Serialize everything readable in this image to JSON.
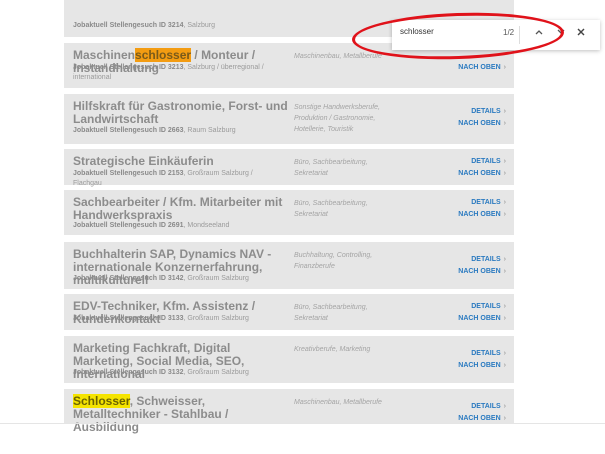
{
  "find": {
    "query": "schlosser",
    "count": "1/2",
    "up_icon": "chevron-up-icon",
    "down_icon": "chevron-down-icon",
    "close_icon": "close-icon"
  },
  "links": {
    "details": "DETAILS",
    "top": "NACH OBEN",
    "chev": "›"
  },
  "cards": [
    {
      "title": "",
      "meta_prefix": "Jobaktuell Stellengesuch ID 3214",
      "meta_rest": ", Salzburg",
      "category": ""
    },
    {
      "title_pre": "Maschinen",
      "title_hl": "schlosser",
      "title_post": " / Monteur / Instandhaltung",
      "meta_prefix": "Jobaktuell Stellengesuch ID 3213",
      "meta_rest": ", Salzburg / überregional / international",
      "category": "Maschinenbau, Metallberufe",
      "details_visible": false
    },
    {
      "title": "Hilfskraft für Gastronomie, Forst- und Landwirtschaft",
      "meta_prefix": "Jobaktuell Stellengesuch ID 2663",
      "meta_rest": ", Raum Salzburg",
      "category": "Sonstige Handwerksberufe, Produktion / Gastronomie, Hotellerie, Touristik"
    },
    {
      "title": "Strategische Einkäuferin",
      "meta_prefix": "Jobaktuell Stellengesuch ID 2153",
      "meta_rest": ", Großraum Salzburg / Flachgau",
      "category": "Büro, Sachbearbeitung, Sekretariat"
    },
    {
      "title": "Sachbearbeiter / Kfm. Mitarbeiter mit Handwerkspraxis",
      "meta_prefix": "Jobaktuell Stellengesuch ID 2691",
      "meta_rest": ", Mondseeland",
      "category": "Büro, Sachbearbeitung, Sekretariat"
    },
    {
      "title": "Buchhalterin SAP, Dynamics NAV - internationale Konzernerfahrung, multikulturell",
      "meta_prefix": "Jobaktuell Stellengesuch ID 3142",
      "meta_rest": ", Großraum Salzburg",
      "category": "Buchhaltung, Controlling, Finanzberufe"
    },
    {
      "title": "EDV-Techniker, Kfm. Assistenz / Kundenkontakt",
      "meta_prefix": "Jobaktuell Stellengesuch ID 3133",
      "meta_rest": ", Großraum Salzburg",
      "category": "Büro, Sachbearbeitung, Sekretariat"
    },
    {
      "title": "Marketing Fachkraft, Digital Marketing, Social Media, SEO, International",
      "meta_prefix": "Jobaktuell Stellengesuch ID 3132",
      "meta_rest": ", Großraum Salzburg",
      "category": "Kreativberufe, Marketing"
    },
    {
      "title_hl2": "Schlosser",
      "title_post": ", Schweisser, Metalltechniker - Stahlbau / Ausbildung",
      "category": "Maschinenbau, Metallberufe"
    }
  ]
}
